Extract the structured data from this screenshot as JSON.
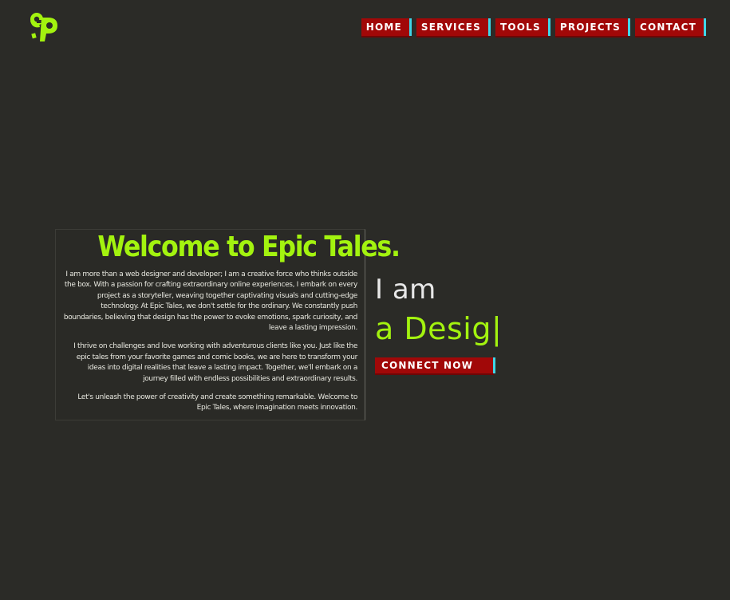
{
  "brand": {
    "logo_icon": "ep-logo-icon",
    "accent_color": "#a3f30f",
    "button_color": "#a10808",
    "button_edge_color": "#3fd6e8",
    "background_color": "#2b2b27"
  },
  "nav": {
    "items": [
      {
        "label": "HOME"
      },
      {
        "label": "SERVICES"
      },
      {
        "label": "TOOLS"
      },
      {
        "label": "PROJECTS"
      },
      {
        "label": "CONTACT"
      }
    ]
  },
  "welcome": {
    "title": "Welcome to Epic Tales.",
    "paragraphs": [
      "I am more than a web designer and developer; I am a creative force who thinks outside the box. With a passion for crafting extraordinary online experiences, I embark on every project as a storyteller, weaving together captivating visuals and cutting-edge technology. At Epic Tales, we don't settle for the ordinary. We constantly push boundaries, believing that design has the power to evoke emotions, spark curiosity, and leave a lasting impression.",
      "I thrive on challenges and love working with adventurous clients like you. Just like the epic tales from your favorite games and comic books, we are here to transform your ideas into digital realities that leave a lasting impact. Together, we'll embark on a journey filled with endless possibilities and extraordinary results.",
      "Let's unleash the power of creativity and create something remarkable. Welcome to Epic Tales, where imagination meets innovation."
    ]
  },
  "hero": {
    "intro": "I am",
    "typed_text": "a Desig|",
    "cta_label": "CONNECT NOW"
  }
}
